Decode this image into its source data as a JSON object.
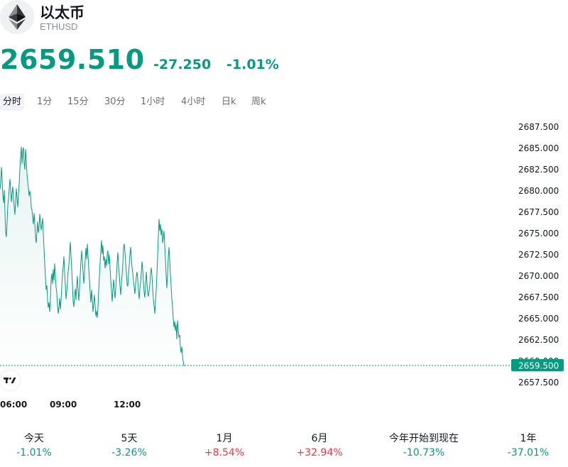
{
  "header": {
    "title": "以太币",
    "symbol": "ETHUSD",
    "logo_icon": "ethereum-icon"
  },
  "quote": {
    "price": "2659.510",
    "change": "-27.250",
    "change_pct": "-1.01%",
    "color_down": "#089981",
    "color_up": "#f23645"
  },
  "tabs": [
    {
      "label": "分时",
      "active": true
    },
    {
      "label": "1分"
    },
    {
      "label": "15分"
    },
    {
      "label": "30分"
    },
    {
      "label": "1小时"
    },
    {
      "label": "4小时"
    },
    {
      "label": "日k"
    },
    {
      "label": "周k"
    }
  ],
  "chart_data": {
    "type": "area",
    "x_ticks": [
      "06:00",
      "09:00",
      "12:00"
    ],
    "y_ticks": [
      "2687.500",
      "2685.000",
      "2682.500",
      "2680.000",
      "2677.500",
      "2675.000",
      "2672.500",
      "2670.000",
      "2667.500",
      "2665.000",
      "2662.500",
      "2660.000",
      "2657.500"
    ],
    "ylim": [
      2657.5,
      2687.5
    ],
    "last_value_label": "2659.500",
    "last_value": 2659.5,
    "line_color": "#089981",
    "points": [
      [
        0,
        2680.2
      ],
      [
        1,
        2681.1
      ],
      [
        2,
        2682.8
      ],
      [
        3,
        2681.3
      ],
      [
        4,
        2679.5
      ],
      [
        5,
        2678.6
      ],
      [
        6,
        2680.1
      ],
      [
        7,
        2677.4
      ],
      [
        8,
        2675.2
      ],
      [
        9,
        2674.6
      ],
      [
        10,
        2676.4
      ],
      [
        11,
        2678.3
      ],
      [
        12,
        2679.2
      ],
      [
        13,
        2680.3
      ],
      [
        14,
        2681.4
      ],
      [
        15,
        2680.2
      ],
      [
        16,
        2678.7
      ],
      [
        17,
        2679.7
      ],
      [
        18,
        2680.5
      ],
      [
        19,
        2679.1
      ],
      [
        20,
        2678.2
      ],
      [
        21,
        2677.2
      ],
      [
        22,
        2678.8
      ],
      [
        23,
        2680.3
      ],
      [
        24,
        2679.2
      ],
      [
        25,
        2678.1
      ],
      [
        26,
        2679.6
      ],
      [
        27,
        2680.8
      ],
      [
        28,
        2682.6
      ],
      [
        29,
        2684.0
      ],
      [
        30,
        2685.2
      ],
      [
        31,
        2683.2
      ],
      [
        32,
        2684.7
      ],
      [
        33,
        2685.1
      ],
      [
        34,
        2683.3
      ],
      [
        35,
        2682.5
      ],
      [
        36,
        2684.9
      ],
      [
        37,
        2683.6
      ],
      [
        38,
        2682.0
      ],
      [
        39,
        2681.1
      ],
      [
        40,
        2680.3
      ],
      [
        41,
        2679.4
      ],
      [
        42,
        2680.0
      ],
      [
        43,
        2679.5
      ],
      [
        44,
        2678.1
      ],
      [
        45,
        2677.8
      ],
      [
        46,
        2676.9
      ],
      [
        47,
        2676.1
      ],
      [
        48,
        2677.4
      ],
      [
        49,
        2676.2
      ],
      [
        50,
        2674.6
      ],
      [
        51,
        2673.9
      ],
      [
        52,
        2675.2
      ],
      [
        53,
        2676.4
      ],
      [
        54,
        2675.1
      ],
      [
        55,
        2675.7
      ],
      [
        56,
        2677.3
      ],
      [
        57,
        2676.3
      ],
      [
        58,
        2675.4
      ],
      [
        59,
        2676.1
      ],
      [
        60,
        2676.8
      ],
      [
        61,
        2675.0
      ],
      [
        62,
        2673.3
      ],
      [
        63,
        2671.5
      ],
      [
        64,
        2669.8
      ],
      [
        65,
        2668.4
      ],
      [
        66,
        2668.9
      ],
      [
        67,
        2667.2
      ],
      [
        68,
        2666.3
      ],
      [
        69,
        2666.9
      ],
      [
        70,
        2665.8
      ],
      [
        71,
        2667.5
      ],
      [
        72,
        2669.6
      ],
      [
        73,
        2670.3
      ],
      [
        74,
        2669.1
      ],
      [
        75,
        2670.8
      ],
      [
        76,
        2669.5
      ],
      [
        77,
        2671.5
      ],
      [
        78,
        2670.0
      ],
      [
        79,
        2668.7
      ],
      [
        80,
        2668.0
      ],
      [
        81,
        2666.5
      ],
      [
        82,
        2665.6
      ],
      [
        83,
        2666.4
      ],
      [
        84,
        2667.4
      ],
      [
        85,
        2666.1
      ],
      [
        86,
        2667.2
      ],
      [
        87,
        2668.8
      ],
      [
        88,
        2670.3
      ],
      [
        89,
        2671.1
      ],
      [
        90,
        2672.3
      ],
      [
        91,
        2670.5
      ],
      [
        92,
        2668.9
      ],
      [
        93,
        2667.3
      ],
      [
        94,
        2668.2
      ],
      [
        95,
        2669.4
      ],
      [
        96,
        2670.6
      ],
      [
        97,
        2671.3
      ],
      [
        98,
        2672.7
      ],
      [
        99,
        2674.0
      ],
      [
        100,
        2672.4
      ],
      [
        101,
        2670.8
      ],
      [
        102,
        2669.1
      ],
      [
        103,
        2667.0
      ],
      [
        104,
        2666.4
      ],
      [
        105,
        2667.8
      ],
      [
        106,
        2668.5
      ],
      [
        107,
        2667.2
      ],
      [
        108,
        2668.9
      ],
      [
        109,
        2670.0
      ],
      [
        110,
        2668.3
      ],
      [
        111,
        2667.1
      ],
      [
        112,
        2668.6
      ],
      [
        113,
        2670.2
      ],
      [
        114,
        2671.8
      ],
      [
        115,
        2673.0
      ],
      [
        116,
        2671.7
      ],
      [
        117,
        2670.5
      ],
      [
        118,
        2669.1
      ],
      [
        119,
        2670.3
      ],
      [
        120,
        2671.9
      ],
      [
        121,
        2673.3
      ],
      [
        122,
        2672.0
      ],
      [
        123,
        2673.8
      ],
      [
        124,
        2672.4
      ],
      [
        125,
        2670.9
      ],
      [
        126,
        2669.5
      ],
      [
        127,
        2668.0
      ],
      [
        128,
        2666.9
      ],
      [
        129,
        2668.4
      ],
      [
        130,
        2667.2
      ],
      [
        131,
        2665.8
      ],
      [
        132,
        2666.8
      ],
      [
        133,
        2667.8
      ],
      [
        134,
        2666.5
      ],
      [
        135,
        2665.3
      ],
      [
        136,
        2665.9
      ],
      [
        137,
        2665.1
      ],
      [
        138,
        2666.4
      ],
      [
        139,
        2668.3
      ],
      [
        140,
        2670.0
      ],
      [
        141,
        2671.6
      ],
      [
        142,
        2672.9
      ],
      [
        143,
        2674.2
      ],
      [
        144,
        2672.6
      ],
      [
        145,
        2673.6
      ],
      [
        146,
        2671.8
      ],
      [
        147,
        2672.3
      ],
      [
        148,
        2670.9
      ],
      [
        149,
        2672.0
      ],
      [
        150,
        2671.2
      ],
      [
        151,
        2672.6
      ],
      [
        152,
        2673.0
      ],
      [
        153,
        2671.4
      ],
      [
        154,
        2672.5
      ],
      [
        155,
        2670.9
      ],
      [
        156,
        2669.5
      ],
      [
        157,
        2668.2
      ],
      [
        158,
        2667.0
      ],
      [
        159,
        2668.5
      ],
      [
        160,
        2669.6
      ],
      [
        161,
        2668.3
      ],
      [
        162,
        2667.4
      ],
      [
        163,
        2668.7
      ],
      [
        164,
        2670.0
      ],
      [
        165,
        2671.6
      ],
      [
        166,
        2672.8
      ],
      [
        167,
        2671.3
      ],
      [
        168,
        2670.2
      ],
      [
        169,
        2668.8
      ],
      [
        170,
        2667.8
      ],
      [
        171,
        2669.2
      ],
      [
        172,
        2670.1
      ],
      [
        173,
        2671.5
      ],
      [
        174,
        2673.3
      ],
      [
        175,
        2673.8
      ],
      [
        176,
        2672.8
      ],
      [
        177,
        2671.6
      ],
      [
        178,
        2670.4
      ],
      [
        179,
        2669.0
      ],
      [
        180,
        2668.8
      ],
      [
        181,
        2670.1
      ],
      [
        182,
        2671.3
      ],
      [
        183,
        2672.6
      ],
      [
        184,
        2673.4
      ],
      [
        185,
        2672.1
      ],
      [
        186,
        2671.0
      ],
      [
        187,
        2670.3
      ],
      [
        188,
        2669.4
      ],
      [
        189,
        2668.7
      ],
      [
        190,
        2667.9
      ],
      [
        191,
        2669.0
      ],
      [
        192,
        2670.0
      ],
      [
        193,
        2670.5
      ],
      [
        194,
        2669.6
      ],
      [
        195,
        2668.3
      ],
      [
        196,
        2667.3
      ],
      [
        197,
        2668.5
      ],
      [
        198,
        2669.2
      ],
      [
        199,
        2670.4
      ],
      [
        200,
        2671.7
      ],
      [
        201,
        2670.8
      ],
      [
        202,
        2669.4
      ],
      [
        203,
        2668.1
      ],
      [
        204,
        2667.5
      ],
      [
        205,
        2668.9
      ],
      [
        206,
        2670.5
      ],
      [
        207,
        2669.3
      ],
      [
        208,
        2668.0
      ],
      [
        209,
        2667.6
      ],
      [
        210,
        2668.3
      ],
      [
        211,
        2669.0
      ],
      [
        212,
        2670.3
      ],
      [
        213,
        2671.0
      ],
      [
        214,
        2670.1
      ],
      [
        215,
        2668.6
      ],
      [
        216,
        2667.3
      ],
      [
        217,
        2666.5
      ],
      [
        218,
        2665.6
      ],
      [
        219,
        2667.1
      ],
      [
        220,
        2668.4
      ],
      [
        221,
        2670.2
      ],
      [
        222,
        2672.4
      ],
      [
        223,
        2674.6
      ],
      [
        224,
        2676.7
      ],
      [
        225,
        2675.3
      ],
      [
        226,
        2676.1
      ],
      [
        227,
        2674.8
      ],
      [
        228,
        2675.5
      ],
      [
        229,
        2673.9
      ],
      [
        230,
        2674.4
      ],
      [
        231,
        2675.3
      ],
      [
        232,
        2673.7
      ],
      [
        233,
        2672.0
      ],
      [
        234,
        2670.1
      ],
      [
        235,
        2668.6
      ],
      [
        236,
        2670.3
      ],
      [
        237,
        2672.2
      ],
      [
        238,
        2673.4
      ],
      [
        239,
        2671.9
      ],
      [
        240,
        2670.2
      ],
      [
        241,
        2668.8
      ],
      [
        242,
        2667.3
      ],
      [
        243,
        2666.4
      ],
      [
        244,
        2665.0
      ],
      [
        245,
        2664.0
      ],
      [
        246,
        2664.7
      ],
      [
        247,
        2663.6
      ],
      [
        248,
        2664.3
      ],
      [
        249,
        2662.6
      ],
      [
        250,
        2664.8
      ],
      [
        251,
        2663.8
      ],
      [
        252,
        2662.8
      ],
      [
        253,
        2663.1
      ],
      [
        254,
        2661.8
      ],
      [
        255,
        2661.0
      ],
      [
        256,
        2661.7
      ],
      [
        257,
        2660.7
      ],
      [
        258,
        2660.0
      ],
      [
        259,
        2659.5
      ],
      [
        260,
        2659.5
      ]
    ]
  },
  "periods": [
    {
      "label": "今天",
      "value": "-1.01%",
      "dir": "down"
    },
    {
      "label": "5天",
      "value": "-3.26%",
      "dir": "down"
    },
    {
      "label": "1月",
      "value": "+8.54%",
      "dir": "up"
    },
    {
      "label": "6月",
      "value": "+32.94%",
      "dir": "up"
    },
    {
      "label": "今年开始到现在",
      "value": "-10.73%",
      "dir": "down"
    },
    {
      "label": "1年",
      "value": "-37.01%",
      "dir": "down"
    }
  ]
}
